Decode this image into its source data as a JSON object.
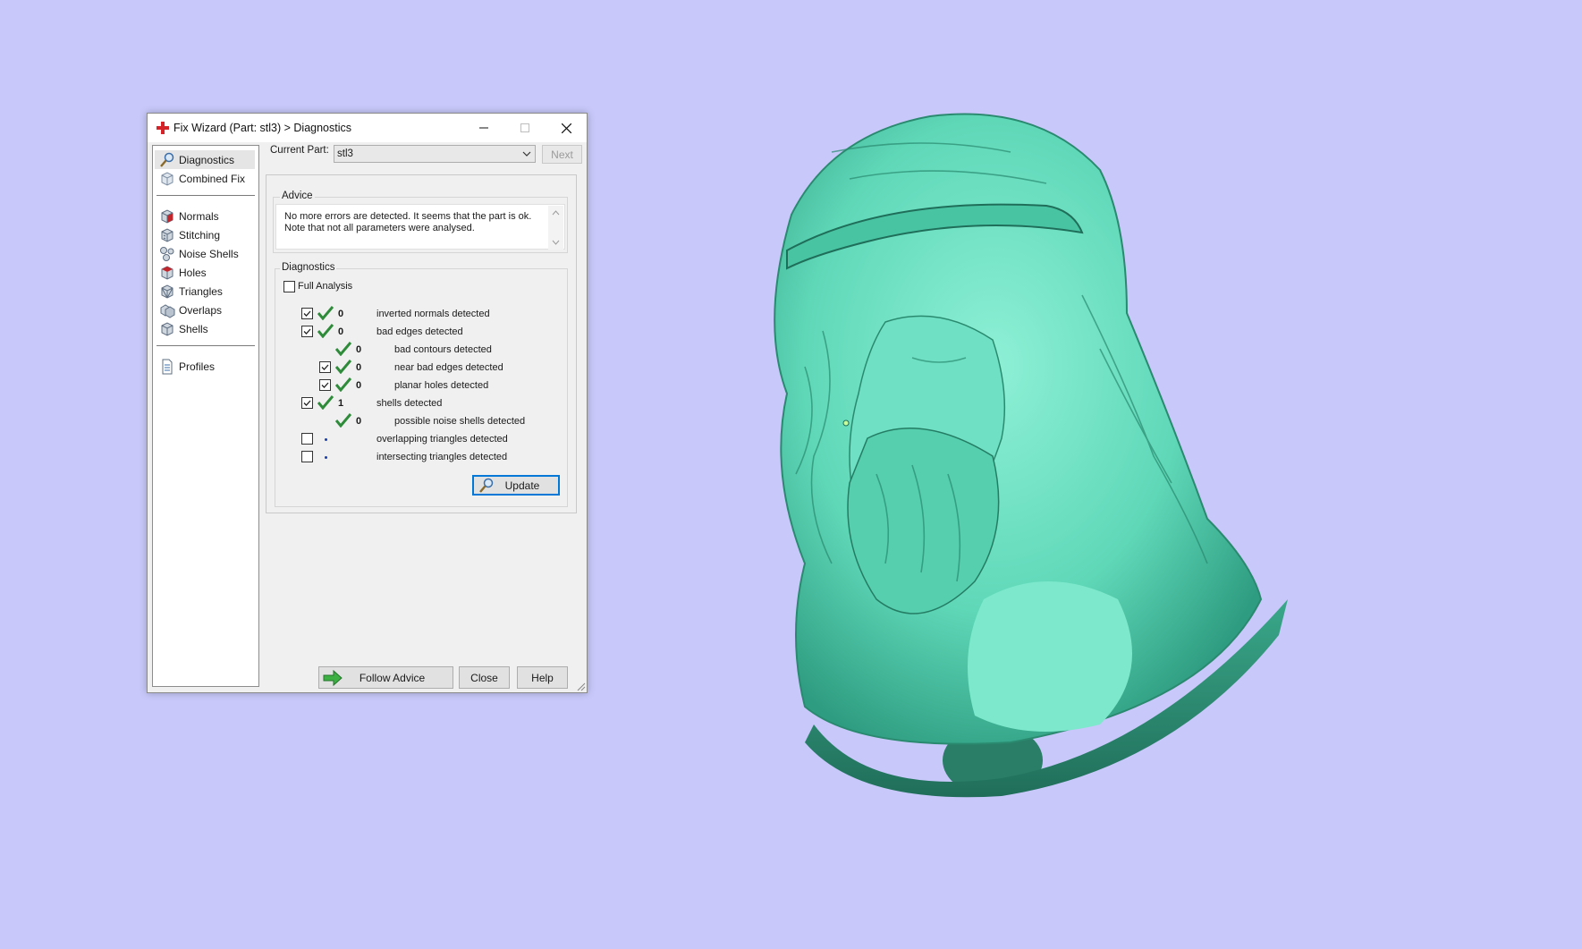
{
  "window": {
    "title": "Fix Wizard (Part: stl3) > Diagnostics"
  },
  "sidebar": {
    "items": [
      {
        "label": "Diagnostics",
        "icon": "magnifier-icon",
        "selected": true
      },
      {
        "label": "Combined Fix",
        "icon": "cube-icon"
      },
      {
        "label": "Normals",
        "icon": "cube-red-face-icon"
      },
      {
        "label": "Stitching",
        "icon": "cube-stitch-icon"
      },
      {
        "label": "Noise Shells",
        "icon": "noise-shells-icon"
      },
      {
        "label": "Holes",
        "icon": "cube-red-edge-icon"
      },
      {
        "label": "Triangles",
        "icon": "cube-triangles-icon"
      },
      {
        "label": "Overlaps",
        "icon": "overlaps-icon"
      },
      {
        "label": "Shells",
        "icon": "cube-shells-icon"
      },
      {
        "label": "Profiles",
        "icon": "document-icon"
      }
    ]
  },
  "top": {
    "current_part_label": "Current Part:",
    "current_part_value": "stl3",
    "next_label": "Next"
  },
  "advice": {
    "title": "Advice",
    "text": "No more errors are detected. It seems that the part is ok. Note that not all parameters were analysed."
  },
  "diagnostics": {
    "title": "Diagnostics",
    "full_analysis_label": "Full Analysis",
    "rows": [
      {
        "count": "0",
        "text": "inverted normals detected"
      },
      {
        "count": "0",
        "text": "bad edges detected"
      },
      {
        "count": "0",
        "text": "bad contours detected"
      },
      {
        "count": "0",
        "text": "near bad edges detected"
      },
      {
        "count": "0",
        "text": "planar holes detected"
      },
      {
        "count": "1",
        "text": "shells detected"
      },
      {
        "count": "0",
        "text": "possible noise shells detected"
      },
      {
        "count": "",
        "text": "overlapping triangles detected"
      },
      {
        "count": "",
        "text": "intersecting triangles detected"
      }
    ],
    "update_label": "Update"
  },
  "footer": {
    "follow_advice_label": "Follow Advice",
    "close_label": "Close",
    "help_label": "Help"
  },
  "colors": {
    "background": "#c8c8fa",
    "model": "#5fd8b8",
    "check": "#2e8b3a"
  }
}
